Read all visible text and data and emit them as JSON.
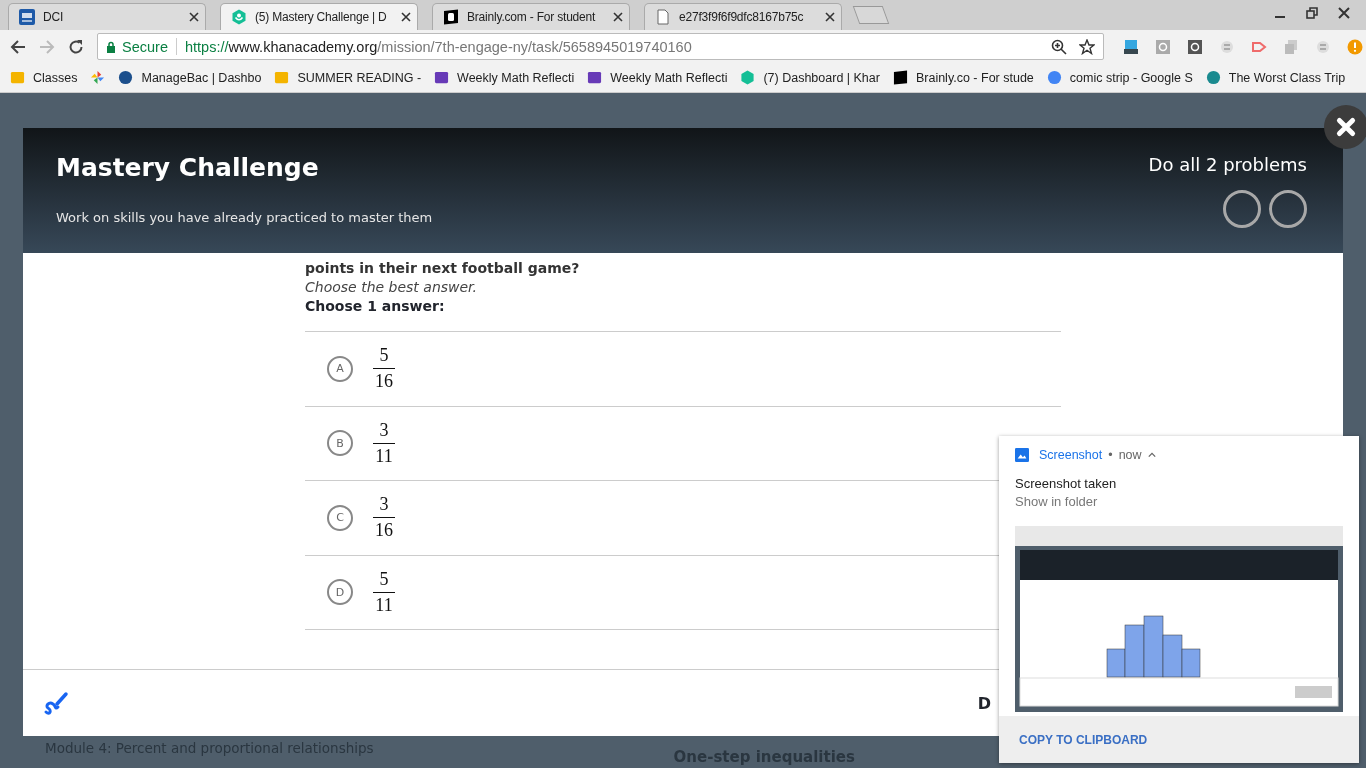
{
  "browser": {
    "tabs": [
      {
        "title": "DCI",
        "selected": false
      },
      {
        "title": "(5) Mastery Challenge | D",
        "selected": true
      },
      {
        "title": "Brainly.com - For student",
        "selected": false
      },
      {
        "title": "e27f3f9f6f9dfc8167b75c",
        "selected": false
      }
    ],
    "address_bar": {
      "security_label": "Secure",
      "url_scheme": "https://",
      "url_host": "www.khanacademy.org",
      "url_path": "/mission/7th-engage-ny/task/5658945019740160"
    },
    "bookmarks": [
      {
        "title": "Classes"
      },
      {
        "title": "ManageBac | Dashbo"
      },
      {
        "title": "SUMMER READING - "
      },
      {
        "title": "Weekly Math Reflecti"
      },
      {
        "title": "Weekly Math Reflecti"
      },
      {
        "title": "(7) Dashboard | Khar"
      },
      {
        "title": "Brainly.co - For stude"
      },
      {
        "title": "comic strip - Google S"
      },
      {
        "title": "The Worst Class Trip"
      }
    ]
  },
  "background_page": {
    "module_title": "Module 4: Percent and proportional relationships",
    "skill_title": "One-step inequalities"
  },
  "modal": {
    "title": "Mastery Challenge",
    "subtitle": "Work on skills you have already practiced to master them",
    "progress_label": "Do all 2 problems",
    "progress_dots": [
      {
        "completed": false
      },
      {
        "completed": false
      }
    ],
    "question": {
      "text": "points in their next football game?",
      "instruction": "Choose the best answer.",
      "prompt": "Choose 1 answer:"
    },
    "choices": [
      {
        "letter": "A",
        "numerator": "5",
        "denominator": "16",
        "selected": false
      },
      {
        "letter": "B",
        "numerator": "3",
        "denominator": "11",
        "selected": false
      },
      {
        "letter": "C",
        "numerator": "3",
        "denominator": "16",
        "selected": false
      },
      {
        "letter": "D",
        "numerator": "5",
        "denominator": "11",
        "selected": false
      }
    ],
    "footer_text": "D"
  },
  "notification": {
    "app": "Screenshot",
    "separator": "•",
    "time": "now",
    "title": "Screenshot taken",
    "link": "Show in folder",
    "action": "COPY TO CLIPBOARD"
  }
}
